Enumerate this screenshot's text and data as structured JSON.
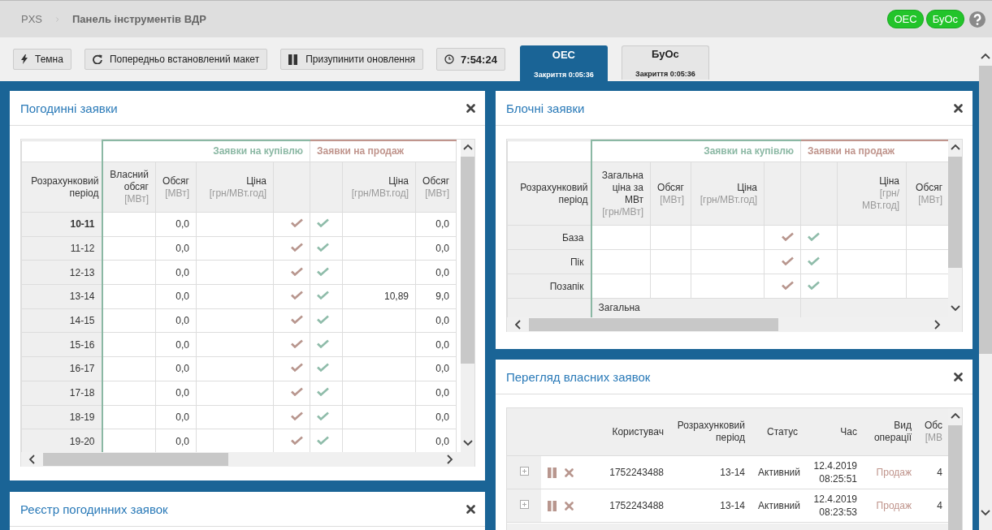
{
  "header": {
    "breadcrumb": [
      "PXS",
      "Панель інструментів ВДР"
    ],
    "badges": [
      "ОЕС",
      "БуОс"
    ]
  },
  "toolbar": {
    "buttons": [
      "Темна",
      "Попередньо встановлений макет",
      "Призупинити оновлення"
    ],
    "clock": "7:54:24"
  },
  "market_tabs": [
    {
      "label": "ОЕС",
      "sub": "Закриття 0:05:36",
      "selected": true
    },
    {
      "label": "БуОс",
      "sub": "Закриття 0:05:36",
      "selected": false
    }
  ],
  "hourly_orders": {
    "title": "Погодинні заявки",
    "buy_group": "Заявки на купівлю",
    "sell_group": "Заявки на продаж",
    "period_column": {
      "label": "Розрахунковий період"
    },
    "buy_columns": [
      {
        "label": "Власний обсяг",
        "unit": "[МВт]"
      },
      {
        "label": "Обсяг",
        "unit": "[МВт]"
      },
      {
        "label": "Ціна",
        "unit": "[грн/МВт.год]"
      }
    ],
    "sell_columns": [
      {
        "label": "Ціна",
        "unit": "[грн/МВт.год]"
      },
      {
        "label": "Обсяг",
        "unit": "[МВт]"
      }
    ],
    "rows": [
      {
        "period": "10-11",
        "volume": "0,0",
        "sell_volume": "0,0",
        "current": true
      },
      {
        "period": "11-12",
        "volume": "0,0",
        "sell_volume": "0,0",
        "current": false
      },
      {
        "period": "12-13",
        "volume": "0,0",
        "sell_volume": "0,0",
        "current": false
      },
      {
        "period": "13-14",
        "volume": "0,0",
        "sell_price": "10,89",
        "sell_volume": "9,0",
        "current": false
      },
      {
        "period": "14-15",
        "volume": "0,0",
        "sell_volume": "0,0",
        "current": false
      },
      {
        "period": "15-16",
        "volume": "0,0",
        "sell_volume": "0,0",
        "current": false
      },
      {
        "period": "16-17",
        "volume": "0,0",
        "sell_volume": "0,0",
        "current": false
      },
      {
        "period": "17-18",
        "volume": "0,0",
        "sell_volume": "0,0",
        "current": false
      },
      {
        "period": "18-19",
        "volume": "0,0",
        "sell_volume": "0,0",
        "current": false
      },
      {
        "period": "19-20",
        "volume": "0,0",
        "sell_volume": "0,0",
        "current": false
      }
    ]
  },
  "hourly_register": {
    "title": "Реєстр погодинних заявок"
  },
  "block_orders": {
    "title": "Блочні заявки",
    "buy_group": "Заявки на купівлю",
    "sell_group": "Заявки на продаж",
    "period_column": {
      "label": "Розрахунковий період"
    },
    "buy_columns": [
      {
        "label": "Загальна ціна за МВт",
        "unit": "[грн/МВт]"
      },
      {
        "label": "Обсяг",
        "unit": "[МВт]"
      },
      {
        "label": "Ціна",
        "unit": "[грн/МВт.год]"
      }
    ],
    "sell_columns": [
      {
        "label": "Ціна",
        "unit": "[грн/МВт.год]"
      },
      {
        "label": "Обсяг",
        "unit": "[МВт]"
      }
    ],
    "rows": [
      {
        "period": "База"
      },
      {
        "period": "Пік"
      },
      {
        "period": "Позапік"
      }
    ],
    "subheader": "Загальна"
  },
  "own_orders": {
    "title": "Перегляд власних заявок",
    "columns": [
      {
        "label": "Користувач"
      },
      {
        "label": "Розрахунковий період"
      },
      {
        "label": "Статус"
      },
      {
        "label": "Час"
      },
      {
        "label": "Вид операції"
      },
      {
        "label": "Обс",
        "unit": "[МВ"
      }
    ],
    "rows": [
      {
        "user": "1752243488",
        "period": "13-14",
        "status": "Активний",
        "date": "12.4.2019",
        "time": "08:25:51",
        "operation": "Продаж",
        "volume": "4"
      },
      {
        "user": "1752243488",
        "period": "13-14",
        "status": "Активний",
        "date": "12.4.2019",
        "time": "08:23:53",
        "operation": "Продаж",
        "volume": "4"
      }
    ]
  }
}
